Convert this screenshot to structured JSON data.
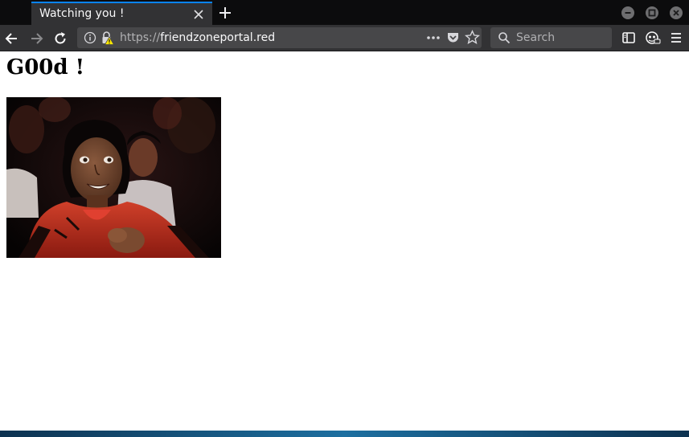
{
  "browser": {
    "tab": {
      "title": "Watching you !"
    },
    "address": {
      "scheme": "https://",
      "host": "friendzoneportal.red"
    },
    "search": {
      "placeholder": "Search"
    }
  },
  "page": {
    "heading": "G00d !"
  },
  "icons": [
    "close-icon",
    "plus-icon",
    "minimize-icon",
    "maximize-icon",
    "window-close-icon",
    "back-arrow-icon",
    "forward-arrow-icon",
    "reload-icon",
    "info-icon",
    "insecure-lock-icon",
    "page-actions-icon",
    "pocket-icon",
    "bookmark-star-icon",
    "search-icon",
    "sidebar-icon",
    "privacy-badge-icon",
    "menu-icon"
  ]
}
